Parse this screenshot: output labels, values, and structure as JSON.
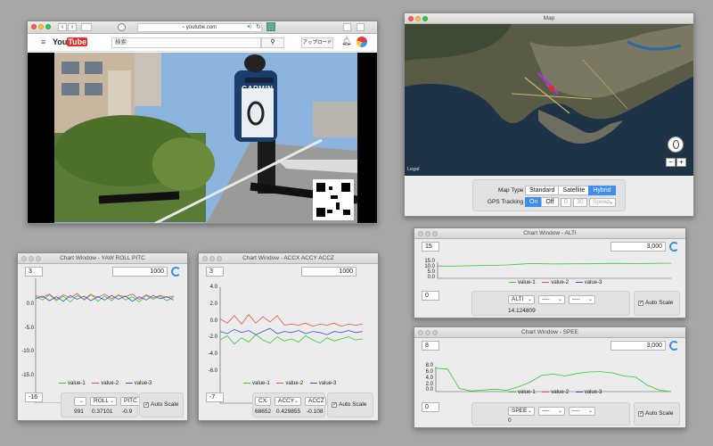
{
  "browser": {
    "url": "youtube.com",
    "search_placeholder": "検索",
    "upload_label": "アップロード",
    "logo_text": "YouTube"
  },
  "map": {
    "title": "Map",
    "map_type_label": "Map Type",
    "map_types": [
      "Standard",
      "Satellite",
      "Hybrid"
    ],
    "selected_map_type": "Hybrid",
    "gps_label": "GPS Tracking",
    "gps_on": "On",
    "gps_off": "Off",
    "gps_field1": "0",
    "gps_field2": "30",
    "gps_mode": "Speed",
    "legal": "Legal",
    "zoom_minus": "−",
    "zoom_plus": "+"
  },
  "chart_yaw": {
    "title": "Chart Window - YAW ROLL PITC",
    "left_field": "3",
    "right_field": "1000",
    "bottom_field": "-16",
    "y_ticks": [
      "0.0",
      "-5.0",
      "-10.0",
      "-15.0"
    ],
    "legend": [
      "value-1",
      "value-2",
      "value-3"
    ],
    "select_1": "",
    "select_2": "ROLL",
    "select_3": "PITC",
    "val_1": "991",
    "val_2": "0.37101",
    "val_3": "-0.9",
    "autoscale": "Auto Scale"
  },
  "chart_acc": {
    "title": "Chart Window - ACCX ACCY ACCZ",
    "left_field": "3",
    "right_field": "1000",
    "bottom_field": "-7",
    "y_ticks": [
      "4.0",
      "2.0",
      "0.0",
      "-2.0",
      "-4.0",
      "-6.0"
    ],
    "legend": [
      "value-1",
      "value-2",
      "value-3"
    ],
    "select_1": "CX",
    "select_2": "ACCY",
    "select_3": "ACCZ",
    "val_1": "68652",
    "val_2": "0.429855",
    "val_3": "-0.108",
    "autoscale": "Auto Scale"
  },
  "chart_alti": {
    "title": "Chart Window - ALTI",
    "left_field": "15",
    "right_field": "3,000",
    "bottom_field": "0",
    "y_ticks": [
      "15.0",
      "10.0",
      "5.0",
      "0.0"
    ],
    "legend": [
      "value-1",
      "value-2",
      "value-3"
    ],
    "select_1": "ALTI",
    "select_2": "----",
    "select_3": "----",
    "val_1": "14.124809",
    "autoscale": "Auto Scale"
  },
  "chart_speed": {
    "title": "Chart Window - SPEE",
    "left_field": "8",
    "right_field": "3,000",
    "bottom_field": "0",
    "y_ticks": [
      "8.0",
      "6.0",
      "4.0",
      "2.0",
      "0.0"
    ],
    "legend": [
      "value-1",
      "value-2",
      "value-3"
    ],
    "select_1": "SPEE",
    "select_2": "----",
    "select_3": "----",
    "val_1": "0",
    "autoscale": "Auto Scale"
  },
  "colors": {
    "value1": "#2fd02f",
    "value2": "#f0524a",
    "value3": "#3c4fd8",
    "accent": "#3d8eef"
  },
  "chart_data": [
    {
      "type": "line",
      "x": [
        0,
        1,
        2,
        3,
        4,
        5,
        6,
        7,
        8,
        9,
        10,
        11,
        12,
        13,
        14,
        15,
        16,
        17,
        18,
        19,
        20
      ],
      "series": [
        {
          "name": "value-1",
          "values": [
            0.2,
            -0.3,
            0.5,
            -0.4,
            0.3,
            -0.6,
            0.4,
            -0.2,
            0.6,
            -0.5,
            0.3,
            -0.4,
            0.5,
            -0.3,
            0.2,
            -0.6,
            0.4,
            -0.2,
            0.3,
            -0.4,
            0.2
          ]
        },
        {
          "name": "value-2",
          "values": [
            0.4,
            0.1,
            0.6,
            -0.2,
            0.5,
            0.0,
            0.7,
            -0.3,
            0.5,
            0.1,
            0.6,
            -0.1,
            0.4,
            0.2,
            0.6,
            -0.2,
            0.5,
            0.0,
            0.4,
            0.1,
            0.3
          ]
        },
        {
          "name": "value-3",
          "values": [
            -0.1,
            0.3,
            -0.4,
            0.2,
            -0.5,
            0.4,
            -0.2,
            0.3,
            -0.4,
            0.2,
            -0.3,
            0.4,
            -0.2,
            0.3,
            -0.5,
            0.2,
            -0.3,
            0.4,
            -0.1,
            0.2,
            -0.3
          ]
        }
      ],
      "ylim": [
        -16,
        3
      ]
    },
    {
      "type": "line",
      "x": [
        0,
        1,
        2,
        3,
        4,
        5,
        6,
        7,
        8,
        9,
        10,
        11,
        12,
        13,
        14,
        15,
        16,
        17,
        18,
        19,
        20
      ],
      "series": [
        {
          "name": "value-1",
          "values": [
            -1.0,
            -0.6,
            -1.4,
            -0.8,
            -1.2,
            -0.5,
            -1.0,
            -1.3,
            -0.7,
            -1.1,
            -0.9,
            -1.2,
            -0.6,
            -1.0,
            -1.3,
            -0.8,
            -1.1,
            -0.9,
            -0.7,
            -1.0,
            -0.9
          ]
        },
        {
          "name": "value-2",
          "values": [
            1.0,
            0.6,
            1.3,
            0.5,
            1.4,
            0.6,
            1.2,
            0.7,
            1.3,
            0.4,
            0.5,
            0.4,
            0.6,
            0.3,
            0.5,
            0.4,
            0.6,
            0.3,
            0.5,
            0.4,
            0.5
          ]
        },
        {
          "name": "value-3",
          "values": [
            -0.2,
            -0.4,
            0.0,
            -0.3,
            -0.1,
            -0.5,
            -0.2,
            0.1,
            -0.4,
            -0.2,
            -0.3,
            -0.1,
            -0.4,
            -0.2,
            -0.3,
            -0.5,
            -0.2,
            -0.3,
            -0.1,
            -0.3,
            -0.2
          ]
        }
      ],
      "ylim": [
        -7,
        4
      ]
    },
    {
      "type": "line",
      "x": [
        0,
        1,
        2,
        3,
        4,
        5,
        6,
        7,
        8,
        9,
        10,
        11,
        12,
        13,
        14,
        15,
        16,
        17,
        18,
        19,
        20
      ],
      "series": [
        {
          "name": "value-1",
          "values": [
            11.5,
            11.3,
            11.6,
            11.8,
            12.0,
            12.2,
            12.5,
            13.2,
            13.8,
            13.6,
            13.4,
            13.5,
            13.7,
            13.6,
            13.8,
            14.0,
            13.9,
            13.8,
            13.9,
            14.1,
            14.12
          ]
        }
      ],
      "ylim": [
        0,
        15
      ]
    },
    {
      "type": "line",
      "x": [
        0,
        1,
        2,
        3,
        4,
        5,
        6,
        7,
        8,
        9,
        10,
        11,
        12,
        13,
        14,
        15,
        16,
        17,
        18,
        19,
        20
      ],
      "series": [
        {
          "name": "value-1",
          "values": [
            7.5,
            7.2,
            1.0,
            0.2,
            0.5,
            0.8,
            0.4,
            1.5,
            3.0,
            5.2,
            5.6,
            5.0,
            5.8,
            6.3,
            6.4,
            6.0,
            5.0,
            4.6,
            2.0,
            0.5,
            0.0
          ]
        }
      ],
      "ylim": [
        0,
        8
      ]
    }
  ]
}
